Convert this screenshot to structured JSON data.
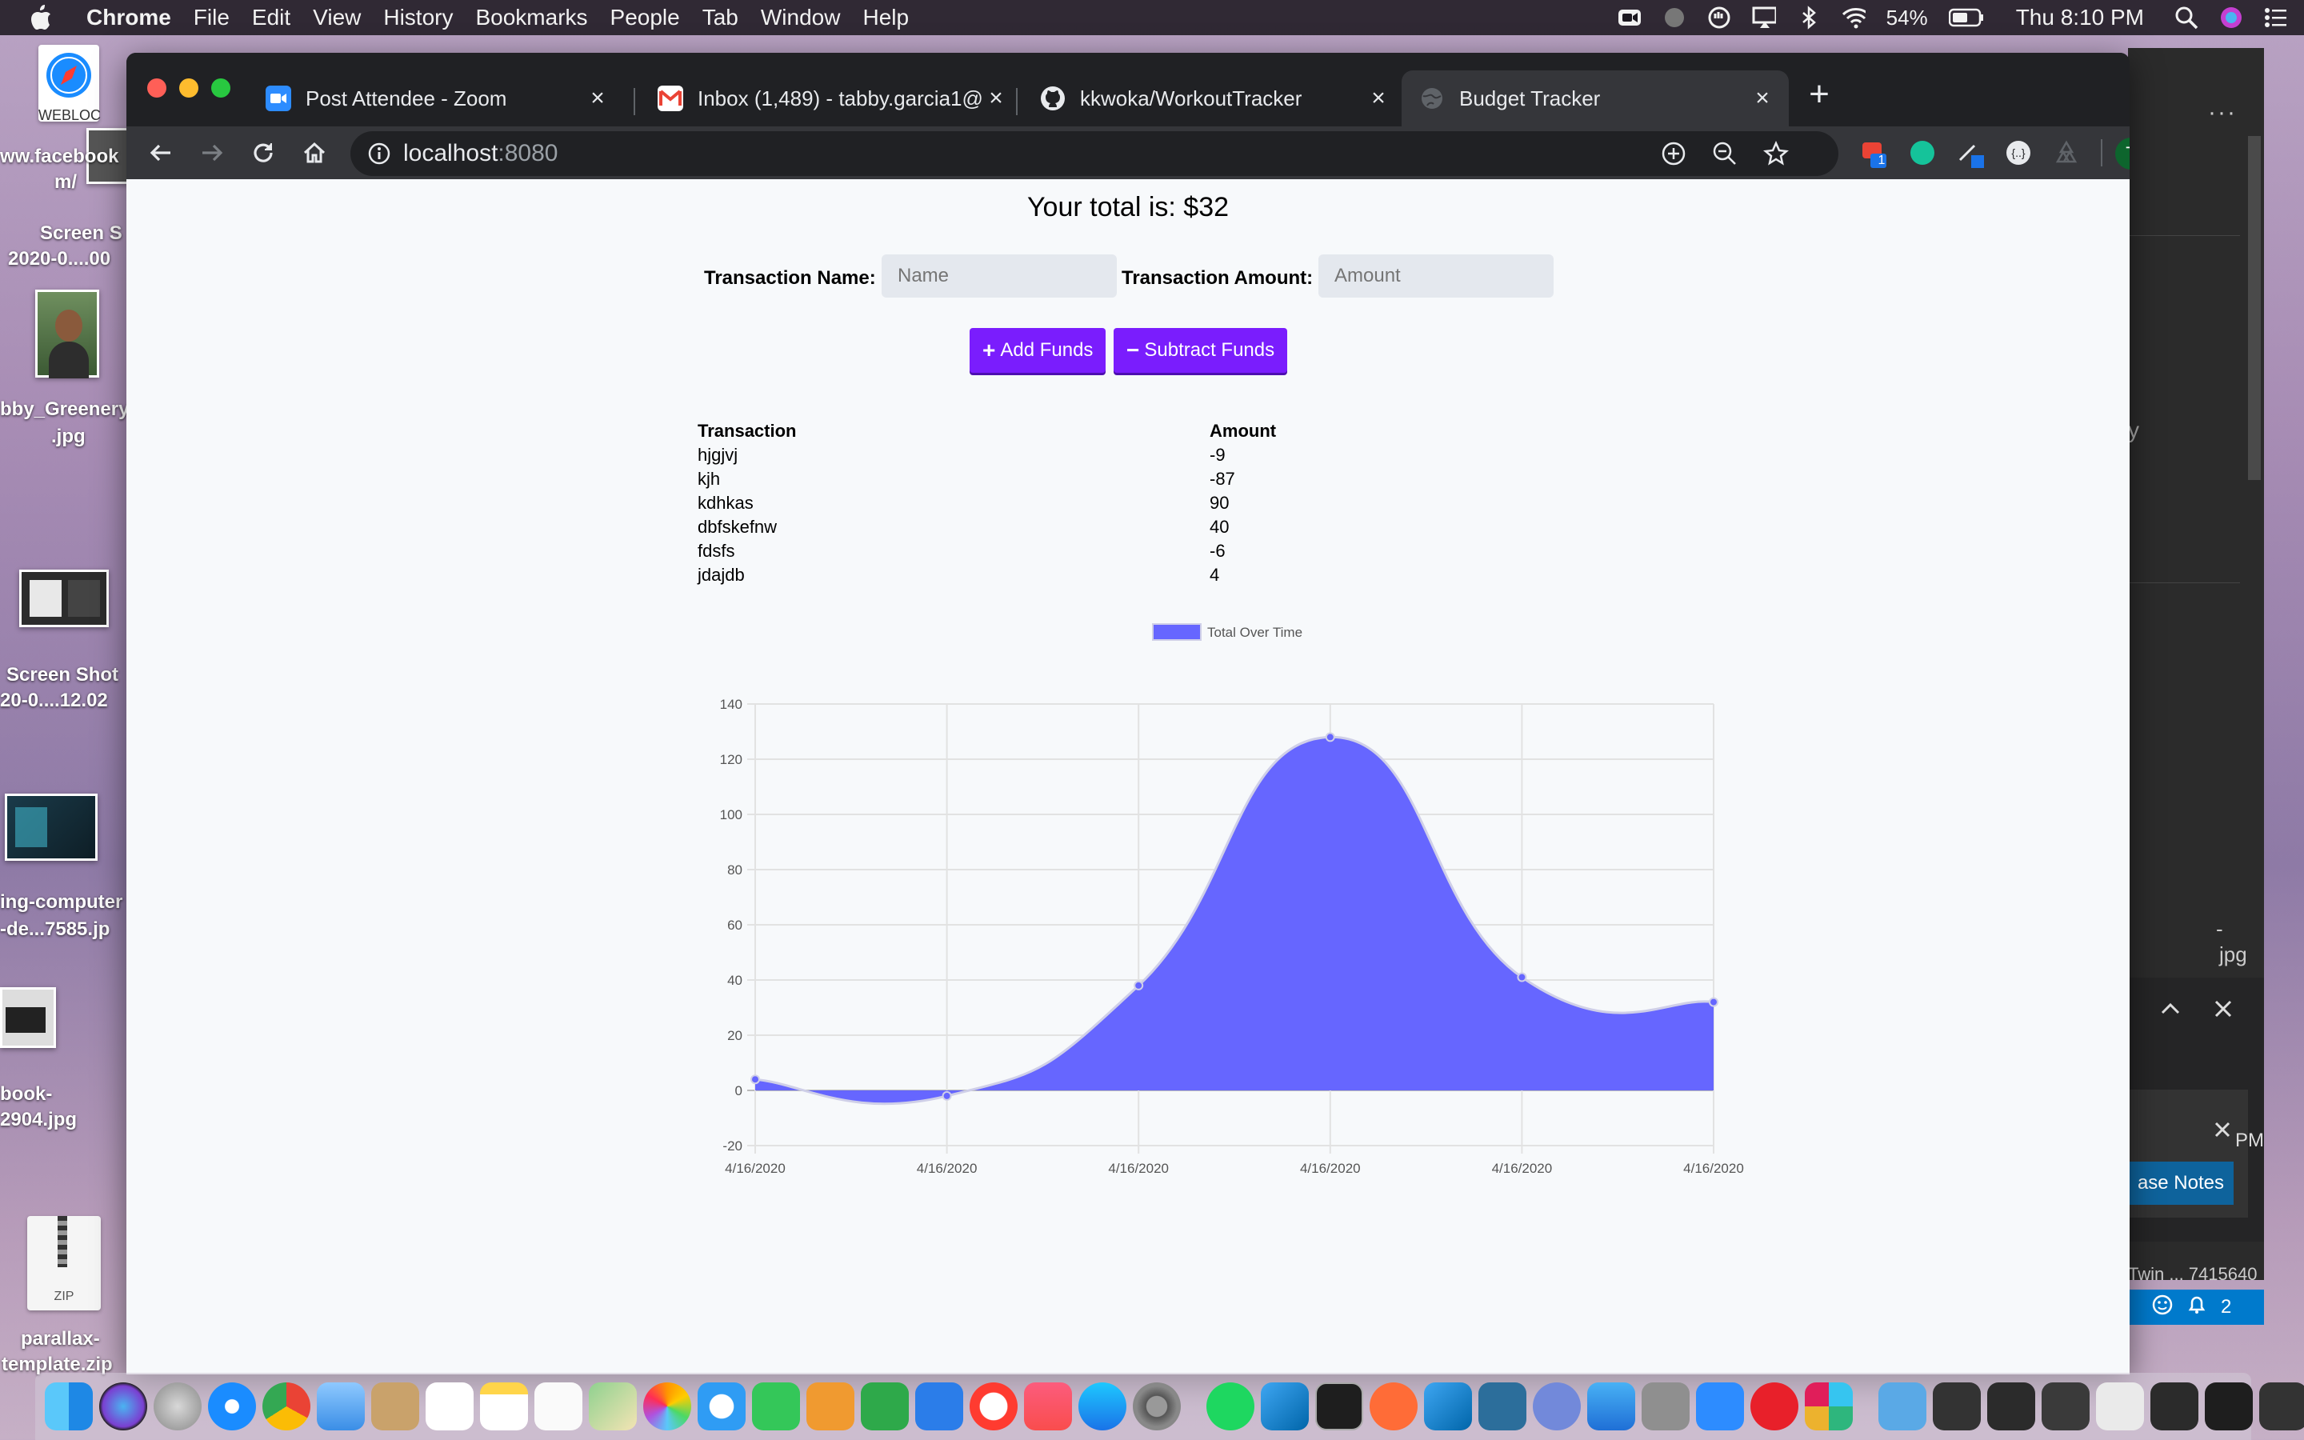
{
  "menubar": {
    "app_name": "Chrome",
    "menus": [
      "File",
      "Edit",
      "View",
      "History",
      "Bookmarks",
      "People",
      "Tab",
      "Window",
      "Help"
    ],
    "battery": "54%",
    "clock": "Thu 8:10 PM"
  },
  "desktop": {
    "items": [
      {
        "label": "WEBLOC"
      },
      {
        "label": "ww.facebook"
      },
      {
        "label": "m/"
      },
      {
        "label": "Screen S"
      },
      {
        "label": "2020-0....00"
      },
      {
        "label": "bby_Greenery"
      },
      {
        "label": ".jpg"
      },
      {
        "label": "Screen Shot"
      },
      {
        "label": "20-0....12.02"
      },
      {
        "label": "ing-computer"
      },
      {
        "label": "-de...7585.jp"
      },
      {
        "label": "book-"
      },
      {
        "label": "2904.jpg"
      },
      {
        "label": "ZIP"
      },
      {
        "label": "parallax-"
      },
      {
        "label": "template.zip"
      }
    ]
  },
  "background_window": {
    "right_text_1": "y",
    "right_text_2": "-",
    "right_text_3": "jpg",
    "right_text_4": "PM",
    "right_text_5": "Twin ... 7415640",
    "release_notes_label": "ase Notes",
    "notifications_count": "2"
  },
  "browser": {
    "tabs": [
      {
        "title": "Post Attendee - Zoom",
        "icon": "zoom-icon"
      },
      {
        "title": "Inbox (1,489) - tabby.garcia1@",
        "icon": "gmail-icon"
      },
      {
        "title": "kkwoka/WorkoutTracker",
        "icon": "github-icon"
      },
      {
        "title": "Budget Tracker",
        "icon": "globe-icon"
      }
    ],
    "url_host": "localhost",
    "url_port": ":8080",
    "extension_badge": "1",
    "profile_initial": "T"
  },
  "page": {
    "total_text": "Your total is: $32",
    "name_label": "Transaction Name:",
    "name_placeholder": "Name",
    "amount_label": "Transaction Amount:",
    "amount_placeholder": "Amount",
    "add_button": "Add Funds",
    "subtract_button": "Subtract Funds",
    "table": {
      "headers": [
        "Transaction",
        "Amount"
      ],
      "rows": [
        [
          "hjgjvj",
          "-9"
        ],
        [
          "kjh",
          "-87"
        ],
        [
          "kdhkas",
          "90"
        ],
        [
          "dbfskefnw",
          "40"
        ],
        [
          "fdsfs",
          "-6"
        ],
        [
          "jdajdb",
          "4"
        ]
      ]
    }
  },
  "chart_data": {
    "type": "area",
    "categories": [
      "4/16/2020",
      "4/16/2020",
      "4/16/2020",
      "4/16/2020",
      "4/16/2020",
      "4/16/2020"
    ],
    "series": [
      {
        "name": "Total Over Time",
        "values": [
          4,
          -2,
          38,
          128,
          41,
          32
        ],
        "color": "#6666ff"
      }
    ],
    "ylim": [
      -20,
      140
    ],
    "yticks": [
      -20,
      0,
      20,
      40,
      60,
      80,
      100,
      120,
      140
    ],
    "grid": true,
    "legend": "top-center"
  },
  "colors": {
    "button_purple": "#7a1dfd",
    "area_fill": "#6666ff",
    "page_bg": "#f7f9fb"
  }
}
